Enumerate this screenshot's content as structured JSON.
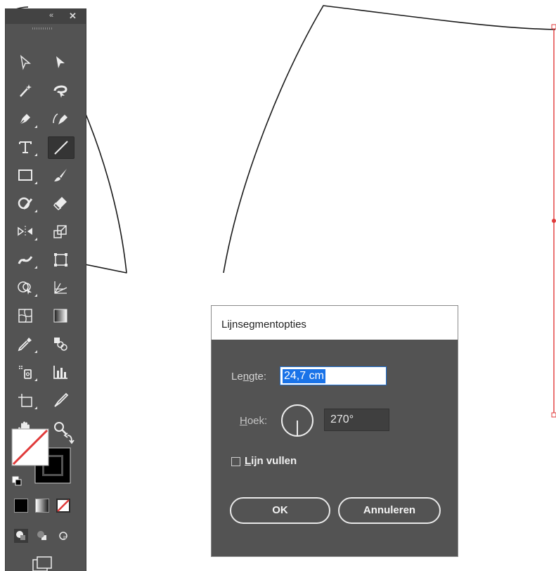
{
  "toolbar": {
    "collapse_glyph": "«",
    "close_glyph": "✕",
    "tools": [
      {
        "name": "selection-tool-icon"
      },
      {
        "name": "direct-selection-tool-icon"
      },
      {
        "name": "magic-wand-tool-icon"
      },
      {
        "name": "lasso-tool-icon"
      },
      {
        "name": "pen-tool-icon"
      },
      {
        "name": "curvature-tool-icon"
      },
      {
        "name": "type-tool-icon"
      },
      {
        "name": "line-segment-tool-icon"
      },
      {
        "name": "rectangle-tool-icon"
      },
      {
        "name": "paintbrush-tool-icon"
      },
      {
        "name": "shaper-tool-icon"
      },
      {
        "name": "eraser-tool-icon"
      },
      {
        "name": "reflect-tool-icon"
      },
      {
        "name": "scale-tool-icon"
      },
      {
        "name": "width-tool-icon"
      },
      {
        "name": "free-transform-tool-icon"
      },
      {
        "name": "shape-builder-tool-icon"
      },
      {
        "name": "perspective-grid-tool-icon"
      },
      {
        "name": "mesh-tool-icon"
      },
      {
        "name": "gradient-tool-icon"
      },
      {
        "name": "eyedropper-tool-icon"
      },
      {
        "name": "blend-tool-icon"
      },
      {
        "name": "symbol-sprayer-tool-icon"
      },
      {
        "name": "column-graph-tool-icon"
      },
      {
        "name": "artboard-tool-icon"
      },
      {
        "name": "slice-tool-icon"
      },
      {
        "name": "hand-tool-icon"
      },
      {
        "name": "zoom-tool-icon"
      }
    ],
    "active_tool": "line-segment-tool-icon",
    "fill_color": "#ffffff",
    "stroke_color": "#000000"
  },
  "dialog": {
    "title": "Lijnsegmentopties",
    "length_label_pre": "Le",
    "length_label_u": "n",
    "length_label_post": "gte:",
    "length_value": "24,7 cm",
    "angle_label_u": "H",
    "angle_label_post": "oek:",
    "angle_value": "270°",
    "fill_line_label_u": "L",
    "fill_line_label_post": "ijn vullen",
    "fill_line_checked": false,
    "ok_label": "OK",
    "cancel_label": "Annuleren"
  },
  "colors": {
    "panel_bg": "#535353",
    "selection_red": "#e03a3a",
    "highlight_blue": "#1a73e8"
  }
}
